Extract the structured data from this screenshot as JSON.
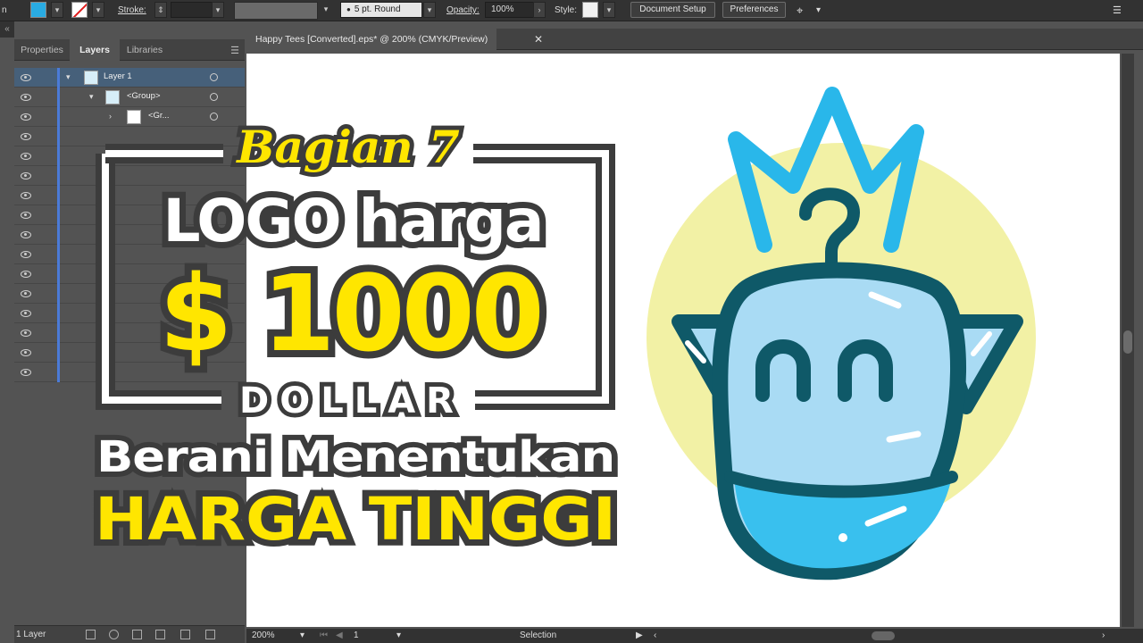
{
  "control_bar": {
    "stroke_label": "Stroke:",
    "brush_value": "5 pt. Round",
    "opacity_label": "Opacity:",
    "opacity_value": "100%",
    "style_label": "Style:",
    "doc_setup_label": "Document Setup",
    "preferences_label": "Preferences",
    "fill_color": "#29abe2"
  },
  "panel": {
    "collapse_icon": "double-chevron-left-icon",
    "tabs": [
      "Properties",
      "Layers",
      "Libraries"
    ],
    "active_tab": "Layers",
    "layers": [
      {
        "name": "Layer 1"
      },
      {
        "name": "<Group>"
      },
      {
        "name": "<Gr..."
      }
    ],
    "footer_count": "1 Layer",
    "layer_color": "#4b7bd8"
  },
  "document": {
    "tab_title": "Happy Tees [Converted].eps* @ 200% (CMYK/Preview)",
    "close_icon": "close-icon"
  },
  "status": {
    "zoom": "200%",
    "artboard_num": "1",
    "tool": "Selection"
  },
  "overlay": {
    "line1": "Bagian 7",
    "line2": "LOGO harga",
    "line3": "$ 1000",
    "line4": "DOLLAR",
    "line5": "Berani Menentukan",
    "line6": "HARGA TINGGI"
  },
  "colors": {
    "logo_dark": "#0f5968",
    "logo_light": "#a9dbf4",
    "logo_blue": "#39c0ee",
    "logo_crown": "#29b7ea",
    "logo_circle": "#f2f1a5",
    "overlay_yellow": "#ffe600"
  }
}
